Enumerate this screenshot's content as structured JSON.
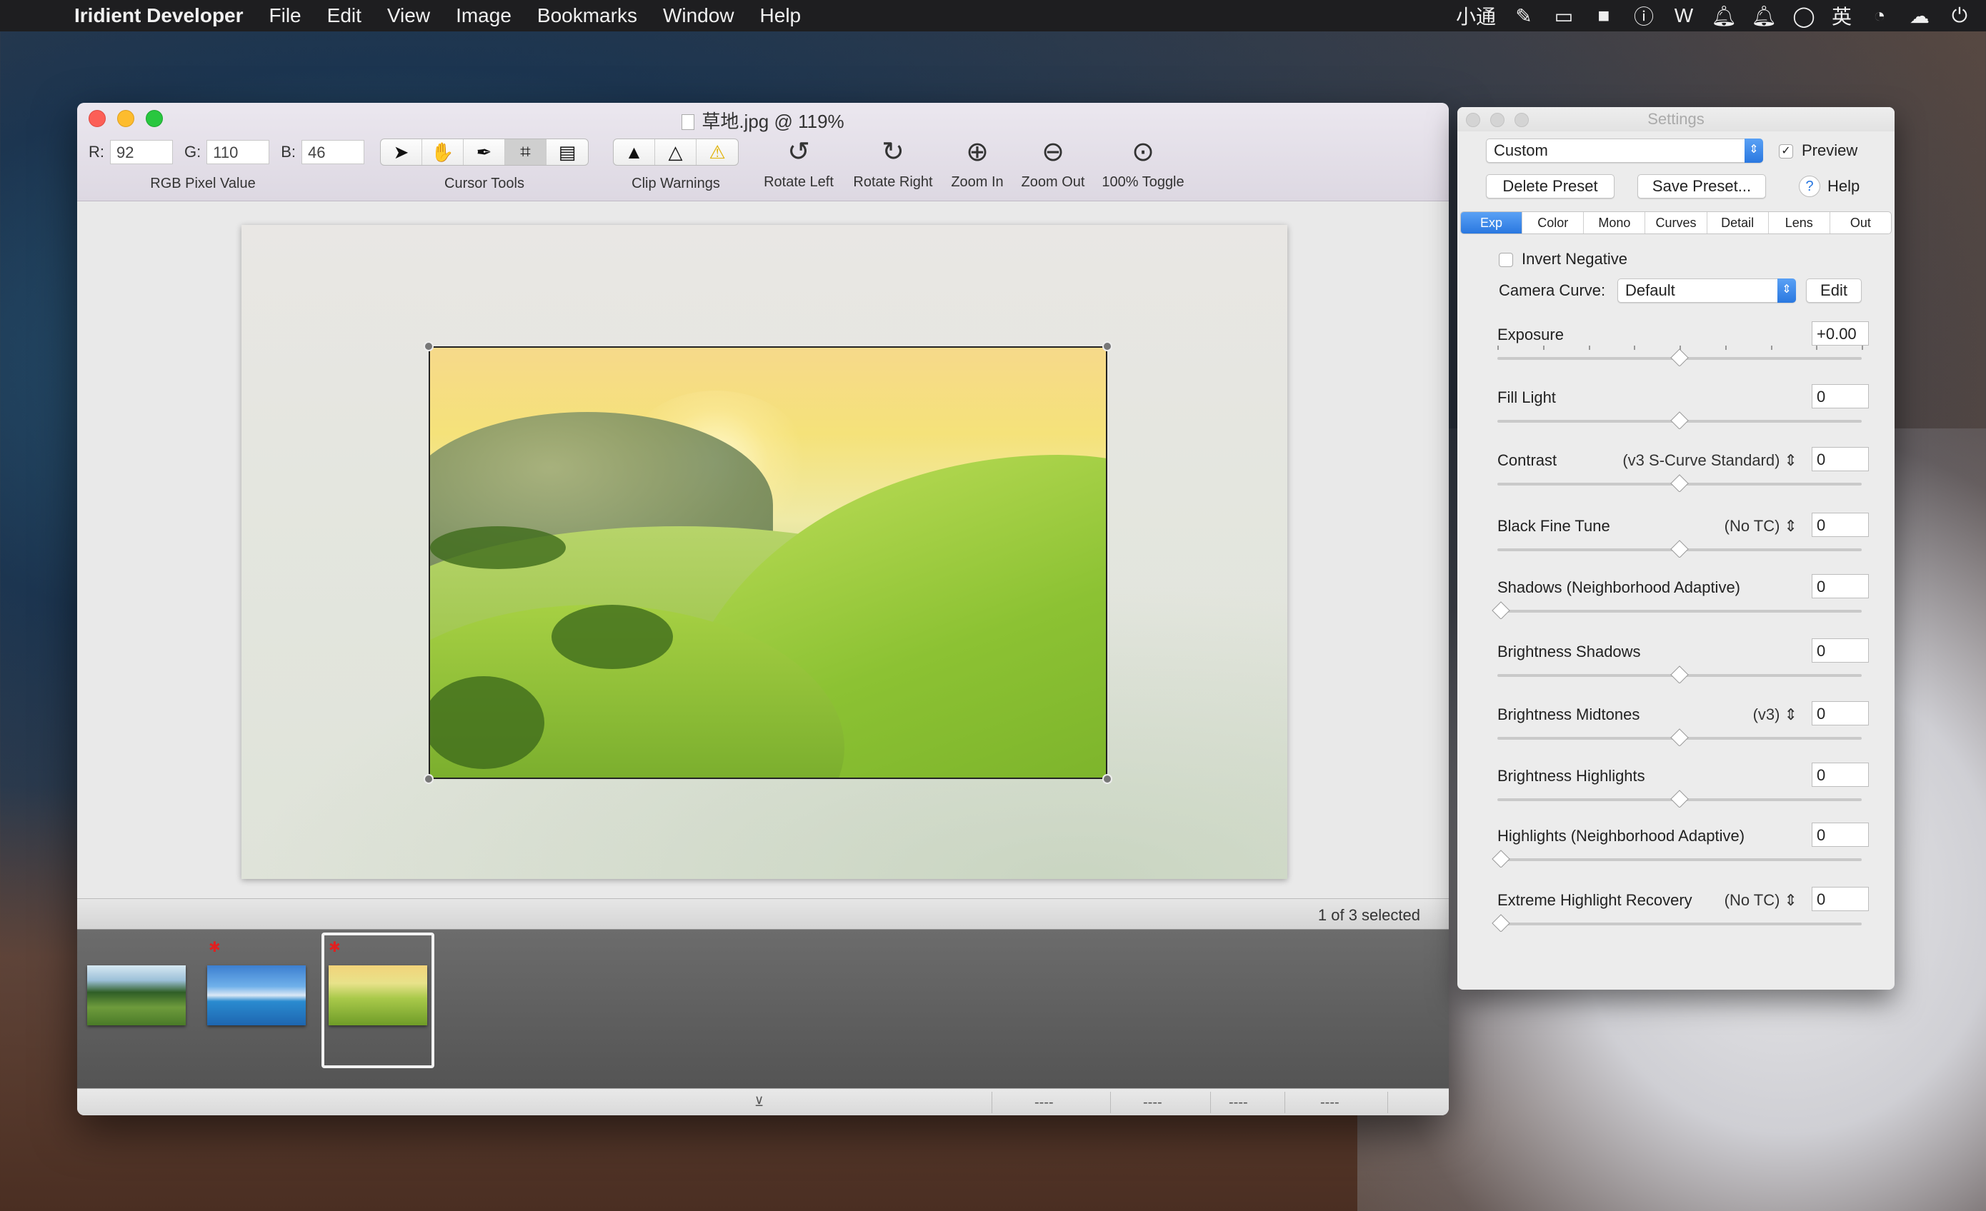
{
  "menubar": {
    "app_name": "Iridient Developer",
    "items": [
      "File",
      "Edit",
      "View",
      "Image",
      "Bookmarks",
      "Window",
      "Help"
    ],
    "status_text": "小通",
    "ime_label": "英"
  },
  "window": {
    "title": "草地.jpg @ 119%",
    "rgb": {
      "r_label": "R:",
      "r": "92",
      "g_label": "G:",
      "g": "110",
      "b_label": "B:",
      "b": "46",
      "caption": "RGB Pixel Value"
    },
    "cursor_tools_caption": "Cursor Tools",
    "clip_warnings_caption": "Clip Warnings",
    "toolbar": {
      "rotate_left": "Rotate Left",
      "rotate_right": "Rotate Right",
      "zoom_in": "Zoom In",
      "zoom_out": "Zoom Out",
      "toggle_100": "100% Toggle"
    },
    "selection_status": "1 of 3 selected",
    "bottom_fields": [
      "----",
      "----",
      "----",
      "----"
    ]
  },
  "settings": {
    "title": "Settings",
    "preset": "Custom",
    "preview_label": "Preview",
    "preview_checked": true,
    "delete_preset": "Delete Preset",
    "save_preset": "Save Preset...",
    "help": "Help",
    "tabs": [
      "Exp",
      "Color",
      "Mono",
      "Curves",
      "Detail",
      "Lens",
      "Out"
    ],
    "active_tab": "Exp",
    "invert_negative": "Invert Negative",
    "camera_curve_label": "Camera Curve:",
    "camera_curve_value": "Default",
    "edit": "Edit",
    "sliders": [
      {
        "label": "Exposure",
        "mode": "",
        "value": "+0.00",
        "pos": 0.5
      },
      {
        "label": "Fill Light",
        "mode": "",
        "value": "0",
        "pos": 0.5
      },
      {
        "label": "Contrast",
        "mode": "(v3 S-Curve Standard)",
        "value": "0",
        "pos": 0.5
      },
      {
        "label": "Black Fine Tune",
        "mode": "(No TC)",
        "value": "0",
        "pos": 0.5
      },
      {
        "label": "Shadows (Neighborhood Adaptive)",
        "mode": "",
        "value": "0",
        "pos": 0.0
      },
      {
        "label": "Brightness Shadows",
        "mode": "",
        "value": "0",
        "pos": 0.5
      },
      {
        "label": "Brightness Midtones",
        "mode": "(v3)",
        "value": "0",
        "pos": 0.5
      },
      {
        "label": "Brightness Highlights",
        "mode": "",
        "value": "0",
        "pos": 0.5
      },
      {
        "label": "Highlights (Neighborhood Adaptive)",
        "mode": "",
        "value": "0",
        "pos": 0.0
      },
      {
        "label": "Extreme Highlight Recovery",
        "mode": "(No TC)",
        "value": "0",
        "pos": 0.0
      }
    ]
  },
  "colors": {
    "accent": "#2a78e0",
    "selected_tab": "#3b82f0",
    "close": "#fc5f57",
    "minimize": "#fdbc2e",
    "maximize": "#29c73f"
  }
}
